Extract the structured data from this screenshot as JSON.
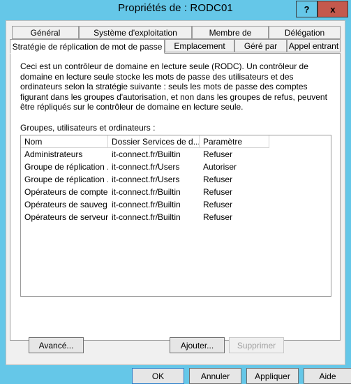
{
  "window": {
    "title": "Propriétés de : RODC01",
    "help_button": "?",
    "close_button": "x",
    "titlebar_color": "#65c7e8",
    "close_button_color": "#c4594d"
  },
  "tabs": [
    {
      "label": "Général",
      "active": false
    },
    {
      "label": "Système d'exploitation",
      "active": false
    },
    {
      "label": "Membre de",
      "active": false
    },
    {
      "label": "Délégation",
      "active": false
    },
    {
      "label": "Stratégie de réplication de mot de passe",
      "active": true
    },
    {
      "label": "Emplacement",
      "active": false
    },
    {
      "label": "Géré par",
      "active": false
    },
    {
      "label": "Appel entrant",
      "active": false
    }
  ],
  "page": {
    "intro": "Ceci est un contrôleur de domaine en lecture seule (RODC). Un contrôleur de domaine en lecture seule stocke les mots de passe des utilisateurs et des ordinateurs selon la stratégie suivante : seuls les mots de passe des comptes figurant dans les groupes d'autorisation, et non dans les groupes de refus, peuvent être répliqués sur le contrôleur de domaine en lecture seule.",
    "groups_label": "Groupes, utilisateurs et ordinateurs :"
  },
  "list": {
    "columns": [
      "Nom",
      "Dossier Services de d...",
      "Paramètre"
    ],
    "rows": [
      [
        "Administrateurs",
        "it-connect.fr/Builtin",
        "Refuser"
      ],
      [
        "Groupe de réplication ...",
        "it-connect.fr/Users",
        "Autoriser"
      ],
      [
        "Groupe de réplication ...",
        "it-connect.fr/Users",
        "Refuser"
      ],
      [
        "Opérateurs de compte",
        "it-connect.fr/Builtin",
        "Refuser"
      ],
      [
        "Opérateurs de sauveg...",
        "it-connect.fr/Builtin",
        "Refuser"
      ],
      [
        "Opérateurs de serveur",
        "it-connect.fr/Builtin",
        "Refuser"
      ]
    ]
  },
  "actions": {
    "advanced": "Avancé...",
    "add": "Ajouter...",
    "remove": "Supprimer"
  },
  "footer": {
    "ok": "OK",
    "cancel": "Annuler",
    "apply": "Appliquer",
    "help": "Aide"
  }
}
